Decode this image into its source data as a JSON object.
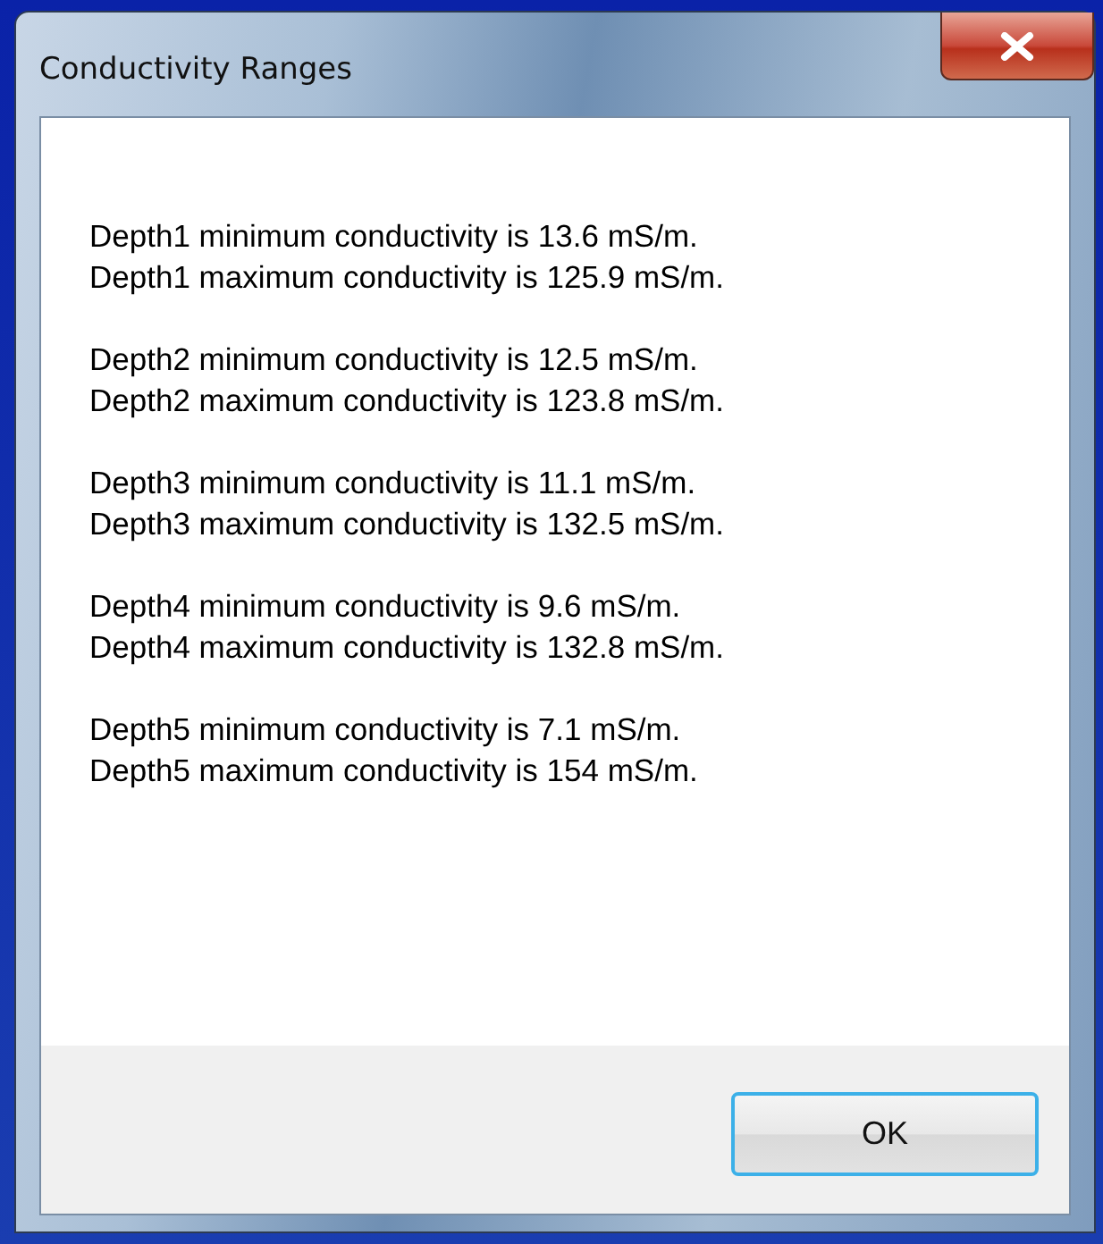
{
  "window": {
    "title": "Conductivity Ranges"
  },
  "message_groups": [
    {
      "lines": [
        "Depth1 minimum conductivity is 13.6 mS/m.",
        "Depth1 maximum conductivity is 125.9 mS/m."
      ]
    },
    {
      "lines": [
        "Depth2 minimum conductivity is 12.5 mS/m.",
        "Depth2 maximum conductivity is 123.8 mS/m."
      ]
    },
    {
      "lines": [
        "Depth3 minimum conductivity is 11.1 mS/m.",
        "Depth3 maximum conductivity is 132.5 mS/m."
      ]
    },
    {
      "lines": [
        "Depth4 minimum conductivity is 9.6 mS/m.",
        "Depth4 maximum conductivity is 132.8 mS/m."
      ]
    },
    {
      "lines": [
        "Depth5 minimum conductivity is 7.1 mS/m.",
        "Depth5 maximum conductivity is 154 mS/m."
      ]
    }
  ],
  "buttons": [
    "OK"
  ]
}
